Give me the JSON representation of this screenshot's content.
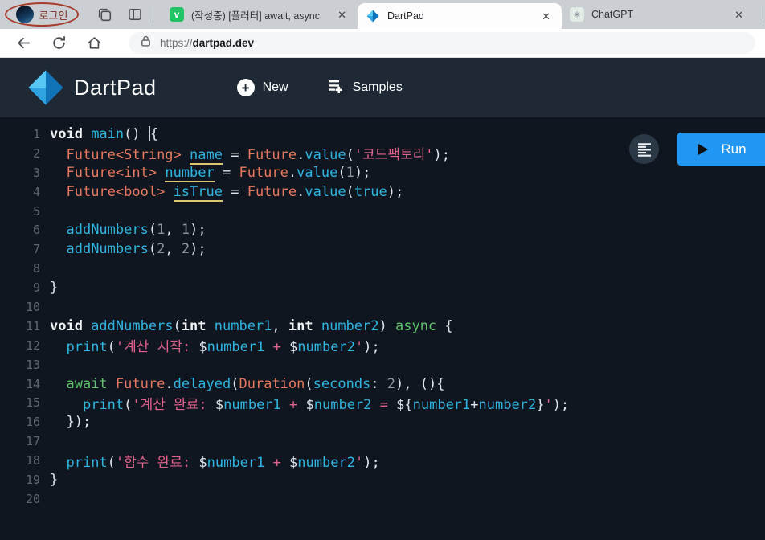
{
  "browser": {
    "profile": {
      "label": "로그인"
    },
    "close_glyph": "✕",
    "tabs": [
      {
        "title": "(작성중) [플러터] await, async",
        "icon": "velog-icon",
        "icon_letter": "v",
        "active": false
      },
      {
        "title": "DartPad",
        "icon": "dartpad-icon",
        "active": true
      },
      {
        "title": "ChatGPT",
        "icon": "chatgpt-icon",
        "icon_glyph": "✳",
        "active": false
      }
    ],
    "address": {
      "protocol": "https://",
      "host": "dartpad.dev"
    }
  },
  "header": {
    "logo_text": "DartPad",
    "new_label": "New",
    "new_plus": "+",
    "samples_label": "Samples"
  },
  "editor": {
    "run_label": "Run",
    "language": "dart",
    "line_count": 20,
    "lines": [
      [
        [
          "kw",
          "void "
        ],
        [
          "fn",
          "main"
        ],
        [
          "pl",
          "() "
        ],
        [
          "cur",
          ""
        ],
        [
          "pl",
          "{"
        ]
      ],
      [
        [
          "pl",
          "  "
        ],
        [
          "type",
          "Future<String>"
        ],
        [
          "pl",
          " "
        ],
        [
          "fnu",
          "name"
        ],
        [
          "pl",
          " = "
        ],
        [
          "type",
          "Future"
        ],
        [
          "pl",
          "."
        ],
        [
          "fn",
          "value"
        ],
        [
          "pl",
          "("
        ],
        [
          "str",
          "'코드팩토리'"
        ],
        [
          "pl",
          ");"
        ]
      ],
      [
        [
          "pl",
          "  "
        ],
        [
          "type",
          "Future<int>"
        ],
        [
          "pl",
          " "
        ],
        [
          "fnu",
          "number"
        ],
        [
          "pl",
          " = "
        ],
        [
          "type",
          "Future"
        ],
        [
          "pl",
          "."
        ],
        [
          "fn",
          "value"
        ],
        [
          "pl",
          "("
        ],
        [
          "num",
          "1"
        ],
        [
          "pl",
          ");"
        ]
      ],
      [
        [
          "pl",
          "  "
        ],
        [
          "type",
          "Future<bool>"
        ],
        [
          "pl",
          " "
        ],
        [
          "fnu",
          "isTrue"
        ],
        [
          "pl",
          " = "
        ],
        [
          "type",
          "Future"
        ],
        [
          "pl",
          "."
        ],
        [
          "fn",
          "value"
        ],
        [
          "pl",
          "("
        ],
        [
          "fn",
          "true"
        ],
        [
          "pl",
          ");"
        ]
      ],
      [],
      [
        [
          "pl",
          "  "
        ],
        [
          "fn",
          "addNumbers"
        ],
        [
          "pl",
          "("
        ],
        [
          "num",
          "1"
        ],
        [
          "pl",
          ", "
        ],
        [
          "num",
          "1"
        ],
        [
          "pl",
          ");"
        ]
      ],
      [
        [
          "pl",
          "  "
        ],
        [
          "fn",
          "addNumbers"
        ],
        [
          "pl",
          "("
        ],
        [
          "num",
          "2"
        ],
        [
          "pl",
          ", "
        ],
        [
          "num",
          "2"
        ],
        [
          "pl",
          ");"
        ]
      ],
      [],
      [
        [
          "pl",
          "}"
        ]
      ],
      [],
      [
        [
          "kw",
          "void "
        ],
        [
          "fn",
          "addNumbers"
        ],
        [
          "pl",
          "("
        ],
        [
          "kw",
          "int "
        ],
        [
          "fn",
          "number1"
        ],
        [
          "pl",
          ", "
        ],
        [
          "kw",
          "int "
        ],
        [
          "fn",
          "number2"
        ],
        [
          "pl",
          ") "
        ],
        [
          "grn",
          "async"
        ],
        [
          "pl",
          " {"
        ]
      ],
      [
        [
          "pl",
          "  "
        ],
        [
          "fn",
          "print"
        ],
        [
          "pl",
          "("
        ],
        [
          "str",
          "'계산 시작: "
        ],
        [
          "pl",
          "$"
        ],
        [
          "fn",
          "number1"
        ],
        [
          "str",
          " + "
        ],
        [
          "pl",
          "$"
        ],
        [
          "fn",
          "number2"
        ],
        [
          "str",
          "'"
        ],
        [
          "pl",
          ");"
        ]
      ],
      [],
      [
        [
          "pl",
          "  "
        ],
        [
          "grn",
          "await"
        ],
        [
          "pl",
          " "
        ],
        [
          "type",
          "Future"
        ],
        [
          "pl",
          "."
        ],
        [
          "fn",
          "delayed"
        ],
        [
          "pl",
          "("
        ],
        [
          "type",
          "Duration"
        ],
        [
          "pl",
          "("
        ],
        [
          "fn",
          "seconds"
        ],
        [
          "pl",
          ": "
        ],
        [
          "num",
          "2"
        ],
        [
          "pl",
          "), (){"
        ]
      ],
      [
        [
          "pl",
          "    "
        ],
        [
          "fn",
          "print"
        ],
        [
          "pl",
          "("
        ],
        [
          "str",
          "'계산 완료: "
        ],
        [
          "pl",
          "$"
        ],
        [
          "fn",
          "number1"
        ],
        [
          "str",
          " + "
        ],
        [
          "pl",
          "$"
        ],
        [
          "fn",
          "number2"
        ],
        [
          "str",
          " = "
        ],
        [
          "pl",
          "${"
        ],
        [
          "fn",
          "number1"
        ],
        [
          "pl",
          "+"
        ],
        [
          "fn",
          "number2"
        ],
        [
          "pl",
          "}"
        ],
        [
          "str",
          "'"
        ],
        [
          "pl",
          ");"
        ]
      ],
      [
        [
          "pl",
          "  });"
        ]
      ],
      [],
      [
        [
          "pl",
          "  "
        ],
        [
          "fn",
          "print"
        ],
        [
          "pl",
          "("
        ],
        [
          "str",
          "'함수 완료: "
        ],
        [
          "pl",
          "$"
        ],
        [
          "fn",
          "number1"
        ],
        [
          "str",
          " + "
        ],
        [
          "pl",
          "$"
        ],
        [
          "fn",
          "number2"
        ],
        [
          "str",
          "'"
        ],
        [
          "pl",
          ");"
        ]
      ],
      [
        [
          "pl",
          "}"
        ]
      ],
      []
    ]
  },
  "colors": {
    "accent_blue": "#2196f3",
    "header_bg": "#1e2935",
    "editor_bg": "#10161f",
    "type_salmon": "#e5785e",
    "identifier_cyan": "#2fb4e0",
    "string_pink": "#e0618c",
    "keyword_green": "#5cc368",
    "underline_yellow": "#dcc66f",
    "velog_green": "#20c464",
    "annotation_red": "#a63c2c"
  }
}
